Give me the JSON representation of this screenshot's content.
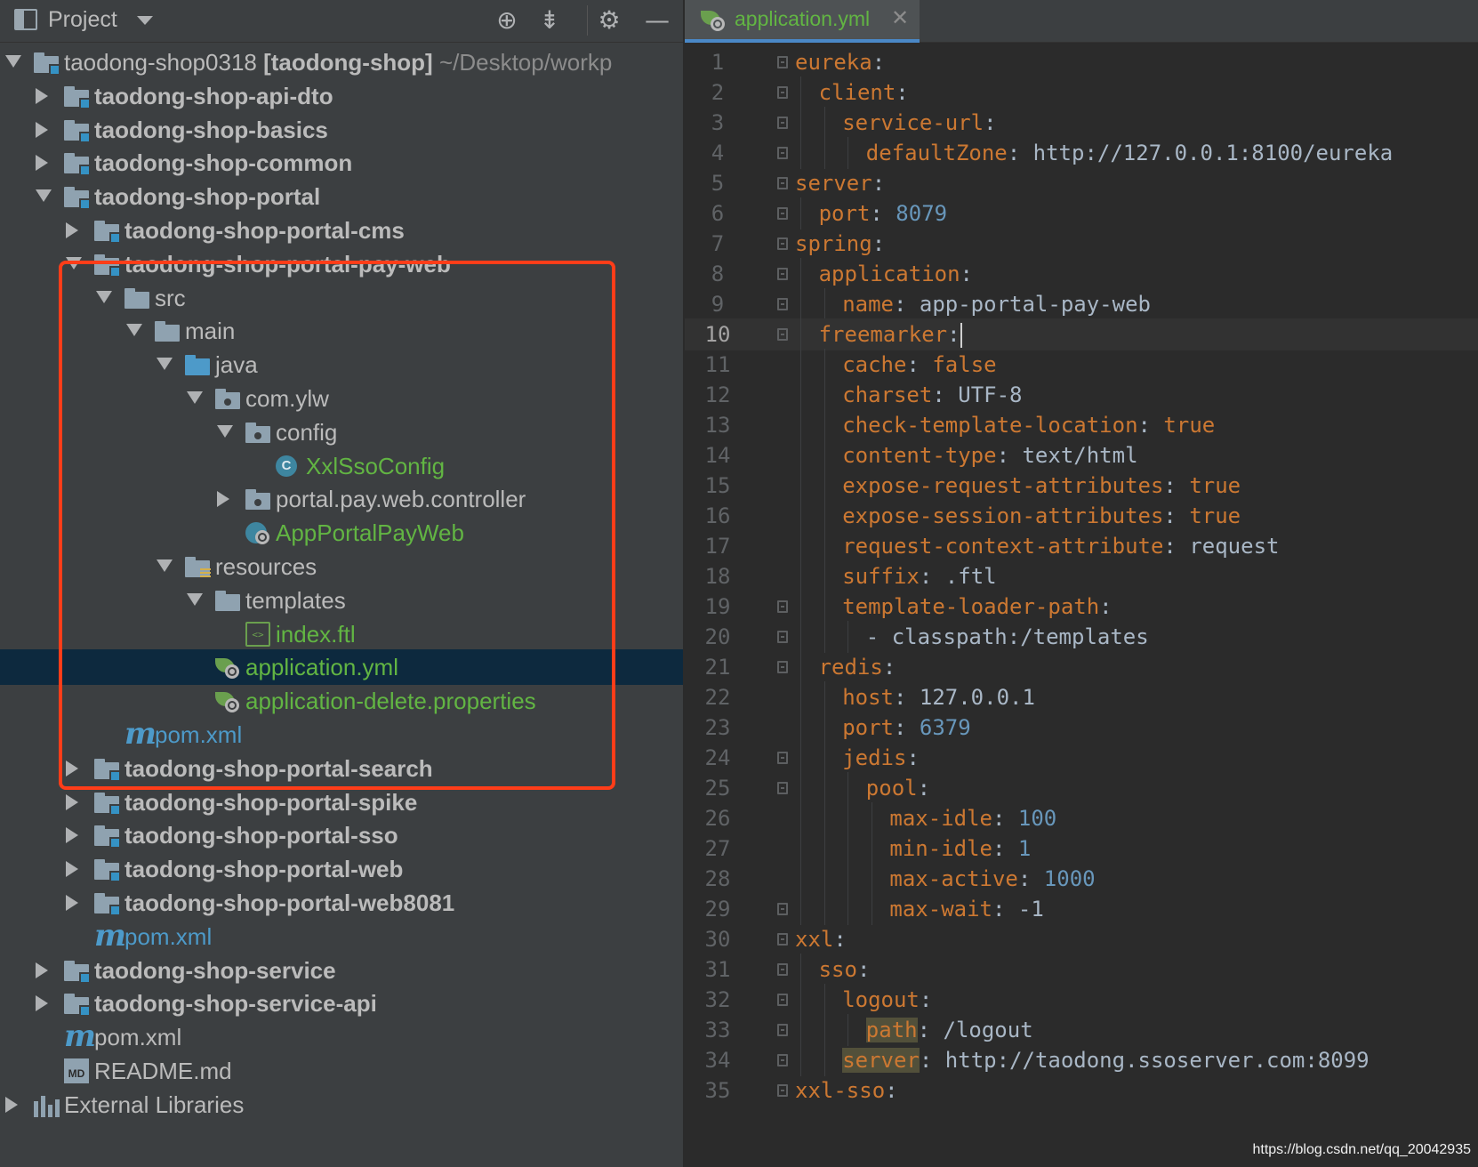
{
  "project_panel": {
    "title": "Project",
    "tools": [
      "locate-icon",
      "collapse-all-icon",
      "gear-icon",
      "minimize-icon"
    ],
    "tree": [
      {
        "label": "taodong-shop0318",
        "suffix": " [taodong-shop]",
        "path": "~/Desktop/workp",
        "icon": "module-folder",
        "arrow": "down"
      },
      {
        "label": "taodong-shop-api-dto",
        "icon": "module-folder",
        "arrow": "right"
      },
      {
        "label": "taodong-shop-basics",
        "icon": "module-folder",
        "arrow": "right"
      },
      {
        "label": "taodong-shop-common",
        "icon": "module-folder",
        "arrow": "right"
      },
      {
        "label": "taodong-shop-portal",
        "icon": "module-folder",
        "arrow": "down"
      },
      {
        "label": "taodong-shop-portal-cms",
        "icon": "module-folder",
        "arrow": "right"
      },
      {
        "label": "taodong-shop-portal-pay-web",
        "icon": "module-folder",
        "arrow": "down"
      },
      {
        "label": "src",
        "icon": "folder",
        "arrow": "down"
      },
      {
        "label": "main",
        "icon": "folder",
        "arrow": "down"
      },
      {
        "label": "java",
        "icon": "source-folder",
        "arrow": "down"
      },
      {
        "label": "com.ylw",
        "icon": "package",
        "arrow": "down"
      },
      {
        "label": "config",
        "icon": "package",
        "arrow": "down"
      },
      {
        "label": "XxlSsoConfig",
        "icon": "class-icon"
      },
      {
        "label": "portal.pay.web.controller",
        "icon": "package",
        "arrow": "right"
      },
      {
        "label": "AppPortalPayWeb",
        "icon": "spring-boot-class-icon"
      },
      {
        "label": "resources",
        "icon": "resources-folder",
        "arrow": "down"
      },
      {
        "label": "templates",
        "icon": "folder",
        "arrow": "down"
      },
      {
        "label": "index.ftl",
        "icon": "ftl-file-icon"
      },
      {
        "label": "application.yml",
        "icon": "spring-config-icon",
        "selected": true
      },
      {
        "label": "application-delete.properties",
        "icon": "spring-config-icon"
      },
      {
        "label": "pom.xml",
        "icon": "maven-icon"
      },
      {
        "label": "taodong-shop-portal-search",
        "icon": "module-folder",
        "arrow": "right"
      },
      {
        "label": "taodong-shop-portal-spike",
        "icon": "module-folder",
        "arrow": "right"
      },
      {
        "label": "taodong-shop-portal-sso",
        "icon": "module-folder",
        "arrow": "right"
      },
      {
        "label": "taodong-shop-portal-web",
        "icon": "module-folder",
        "arrow": "right"
      },
      {
        "label": "taodong-shop-portal-web8081",
        "icon": "module-folder",
        "arrow": "right"
      },
      {
        "label": "pom.xml",
        "icon": "maven-icon"
      },
      {
        "label": "taodong-shop-service",
        "icon": "module-folder",
        "arrow": "right"
      },
      {
        "label": "taodong-shop-service-api",
        "icon": "module-folder",
        "arrow": "right"
      },
      {
        "label": "pom.xml",
        "icon": "maven-icon"
      },
      {
        "label": "README.md",
        "icon": "markdown-icon"
      },
      {
        "label": "External Libraries",
        "icon": "library-icon",
        "arrow": "right"
      }
    ]
  },
  "editor": {
    "tab": {
      "label": "application.yml",
      "close": "✕"
    },
    "current_line": 10,
    "lines": [
      {
        "n": "1",
        "key": "eureka",
        "sep": ":",
        "val": ""
      },
      {
        "n": "2",
        "key": "client",
        "sep": ":",
        "val": ""
      },
      {
        "n": "3",
        "key": "service-url",
        "sep": ":",
        "val": ""
      },
      {
        "n": "4",
        "key": "defaultZone",
        "sep": ":",
        "val": " http://127.0.0.1:8100/eureka"
      },
      {
        "n": "5",
        "key": "server",
        "sep": ":",
        "val": ""
      },
      {
        "n": "6",
        "key": "port",
        "sep": ":",
        "val": " 8079",
        "type": "num"
      },
      {
        "n": "7",
        "key": "spring",
        "sep": ":",
        "val": ""
      },
      {
        "n": "8",
        "key": "application",
        "sep": ":",
        "val": ""
      },
      {
        "n": "9",
        "key": "name",
        "sep": ":",
        "val": " app-portal-pay-web"
      },
      {
        "n": "10",
        "key": "freemarker",
        "sep": ":",
        "val": ""
      },
      {
        "n": "11",
        "key": "cache",
        "sep": ":",
        "val": " false",
        "type": "kw"
      },
      {
        "n": "12",
        "key": "charset",
        "sep": ":",
        "val": " UTF-8"
      },
      {
        "n": "13",
        "key": "check-template-location",
        "sep": ":",
        "val": " true",
        "type": "kw"
      },
      {
        "n": "14",
        "key": "content-type",
        "sep": ":",
        "val": " text/html"
      },
      {
        "n": "15",
        "key": "expose-request-attributes",
        "sep": ":",
        "val": " true",
        "type": "kw"
      },
      {
        "n": "16",
        "key": "expose-session-attributes",
        "sep": ":",
        "val": " true",
        "type": "kw"
      },
      {
        "n": "17",
        "key": "request-context-attribute",
        "sep": ":",
        "val": " request"
      },
      {
        "n": "18",
        "key": "suffix",
        "sep": ":",
        "val": " .ftl"
      },
      {
        "n": "19",
        "key": "template-loader-path",
        "sep": ":",
        "val": ""
      },
      {
        "n": "20",
        "key": "",
        "sep": "- ",
        "val": "classpath:/templates"
      },
      {
        "n": "21",
        "key": "redis",
        "sep": ":",
        "val": ""
      },
      {
        "n": "22",
        "key": "host",
        "sep": ":",
        "val": " 127.0.0.1"
      },
      {
        "n": "23",
        "key": "port",
        "sep": ":",
        "val": " 6379",
        "type": "num"
      },
      {
        "n": "24",
        "key": "jedis",
        "sep": ":",
        "val": ""
      },
      {
        "n": "25",
        "key": "pool",
        "sep": ":",
        "val": ""
      },
      {
        "n": "26",
        "key": "max-idle",
        "sep": ":",
        "val": " 100",
        "type": "num"
      },
      {
        "n": "27",
        "key": "min-idle",
        "sep": ":",
        "val": " 1",
        "type": "num"
      },
      {
        "n": "28",
        "key": "max-active",
        "sep": ":",
        "val": " 1000",
        "type": "num"
      },
      {
        "n": "29",
        "key": "max-wait",
        "sep": ":",
        "val": " -1"
      },
      {
        "n": "30",
        "key": "xxl",
        "sep": ":",
        "val": ""
      },
      {
        "n": "31",
        "key": "sso",
        "sep": ":",
        "val": ""
      },
      {
        "n": "32",
        "key": "logout",
        "sep": ":",
        "val": ""
      },
      {
        "n": "33",
        "key": "path",
        "sep": ":",
        "val": " /logout",
        "hl": true
      },
      {
        "n": "34",
        "key": "server",
        "sep": ":",
        "val": " http://taodong.ssoserver.com:8099",
        "hl": true
      },
      {
        "n": "35",
        "key": "xxl-sso",
        "sep": ":",
        "val": ""
      }
    ]
  },
  "watermark": "https://blog.csdn.net/qq_20042935"
}
